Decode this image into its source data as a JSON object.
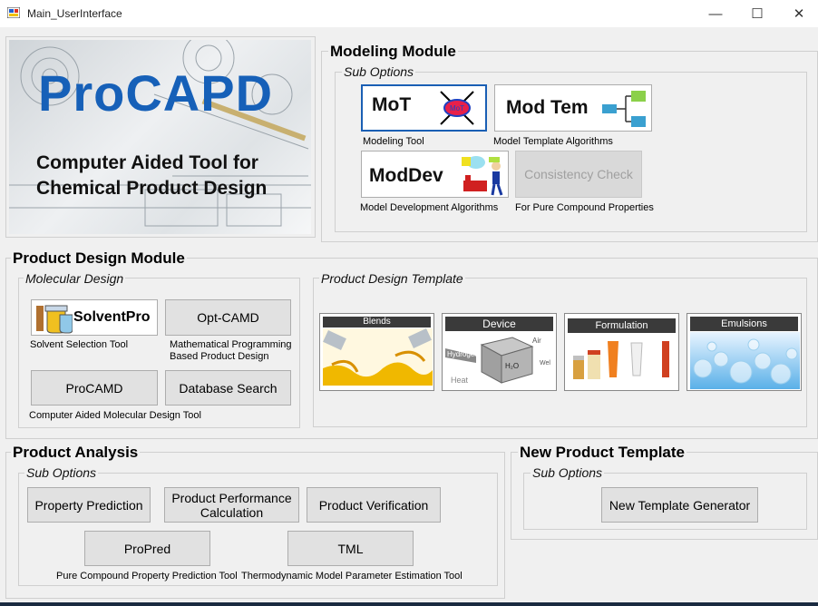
{
  "window": {
    "title": "Main_UserInterface",
    "min_glyph": "—",
    "max_glyph": "☐",
    "close_glyph": "✕"
  },
  "logo": {
    "brand": "ProCAPD",
    "tagline_1": "Computer Aided Tool for",
    "tagline_2": "Chemical Product Design"
  },
  "modeling": {
    "title": "Modeling Module",
    "sub_title": "Sub Options",
    "mot": {
      "label": "MoT",
      "badge": "MoT",
      "caption": "Modeling Tool"
    },
    "modtem": {
      "label": "Mod Tem",
      "caption": "Model Template Algorithms"
    },
    "moddev": {
      "label": "ModDev",
      "caption": "Model Development Algorithms"
    },
    "consistency": {
      "label": "Consistency Check",
      "caption": "For Pure Compound Properties"
    }
  },
  "product_design": {
    "title": "Product Design Module",
    "molecular": {
      "title": "Molecular Design",
      "solventpro": {
        "label": "SolventPro",
        "caption": "Solvent Selection Tool"
      },
      "optcamd": {
        "label": "Opt-CAMD",
        "caption_1": "Mathematical Programming",
        "caption_2": "Based Product Design"
      },
      "procamd": {
        "label": "ProCAMD",
        "caption": "Computer Aided Molecular Design Tool"
      },
      "dbsearch": {
        "label": "Database Search"
      }
    },
    "template": {
      "title": "Product Design Template",
      "tiles": {
        "blends": "Blends",
        "device": "Device",
        "formulation": "Formulation",
        "emulsions": "Emulsions"
      },
      "device_words": {
        "hydrogen": "Hydrogen",
        "heat": "Heat",
        "water": "H₂O",
        "air": "Air",
        "w": "Wel"
      }
    }
  },
  "analysis": {
    "title": "Product Analysis",
    "sub_title": "Sub Options",
    "property_prediction": "Property Prediction",
    "performance_1": "Product Performance",
    "performance_2": "Calculation",
    "verification": "Product Verification",
    "propred": {
      "label": "ProPred",
      "caption": "Pure Compound Property Prediction Tool"
    },
    "tml": {
      "label": "TML",
      "caption": "Thermodynamic Model Parameter Estimation Tool"
    }
  },
  "new_template": {
    "title": "New Product Template",
    "sub_title": "Sub Options",
    "generator": "New Template Generator"
  }
}
